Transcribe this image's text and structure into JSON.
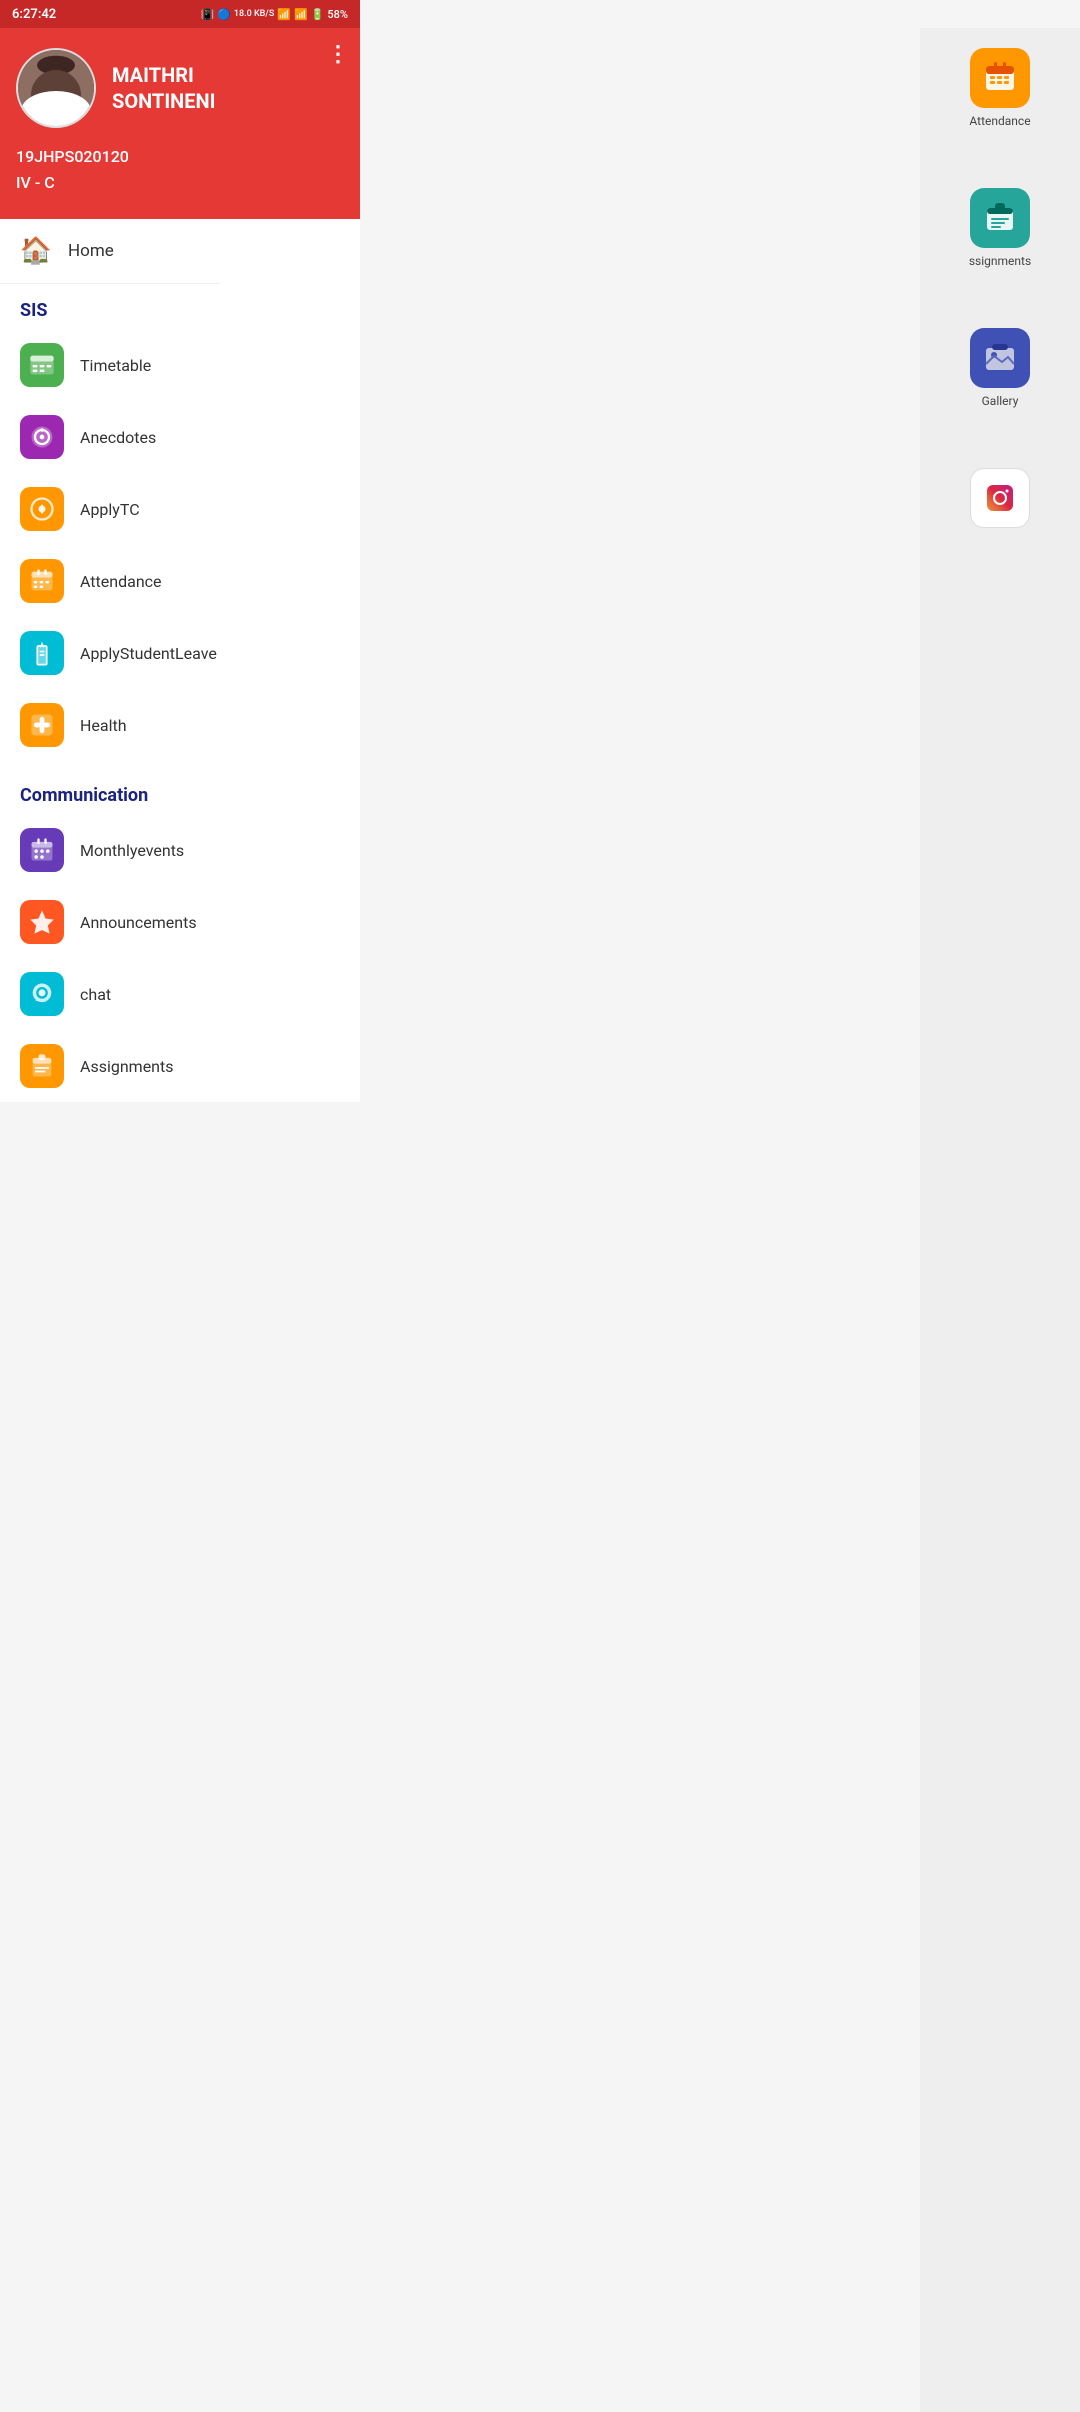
{
  "statusBar": {
    "time": "6:27:42",
    "battery": "58%",
    "signal": "18.0 KB/S"
  },
  "profile": {
    "name": "MAITHRI\nSONTINENI",
    "nameLine1": "MAITHRI",
    "nameLine2": "SONTINENI",
    "id": "19JHPS020120",
    "class": "IV - C"
  },
  "nav": {
    "home": "Home"
  },
  "sections": {
    "sis": {
      "title": "SIS",
      "items": [
        {
          "id": "timetable",
          "label": "Timetable",
          "iconClass": "icon-timetable"
        },
        {
          "id": "anecdotes",
          "label": "Anecdotes",
          "iconClass": "icon-anecdotes"
        },
        {
          "id": "applytc",
          "label": "ApplyTC",
          "iconClass": "icon-applytc"
        },
        {
          "id": "attendance",
          "label": "Attendance",
          "iconClass": "icon-attendance"
        },
        {
          "id": "applyleave",
          "label": "ApplyStudentLeave",
          "iconClass": "icon-applyleave"
        },
        {
          "id": "health",
          "label": "Health",
          "iconClass": "icon-health"
        }
      ]
    },
    "communication": {
      "title": "Communication",
      "items": [
        {
          "id": "monthlyevents",
          "label": "Monthlyevents",
          "iconClass": "icon-monthlyevents"
        },
        {
          "id": "announcements",
          "label": "Announcements",
          "iconClass": "icon-announcements"
        },
        {
          "id": "chat",
          "label": "chat",
          "iconClass": "icon-chat"
        },
        {
          "id": "assignments",
          "label": "Assignments",
          "iconClass": "icon-assignments"
        }
      ]
    }
  },
  "rightPanel": {
    "items": [
      {
        "id": "attendance",
        "label": "Attendance",
        "iconColor": "bg-icon-orange"
      },
      {
        "id": "assignments",
        "label": "ssignments",
        "iconColor": "bg-icon-teal"
      },
      {
        "id": "gallery",
        "label": "Gallery",
        "iconColor": "bg-icon-blue"
      },
      {
        "id": "instagram",
        "label": "",
        "iconColor": "bg-icon-instagram"
      }
    ]
  },
  "colors": {
    "primary": "#e53935",
    "dark": "#c62828",
    "navText": "#1a237e"
  }
}
